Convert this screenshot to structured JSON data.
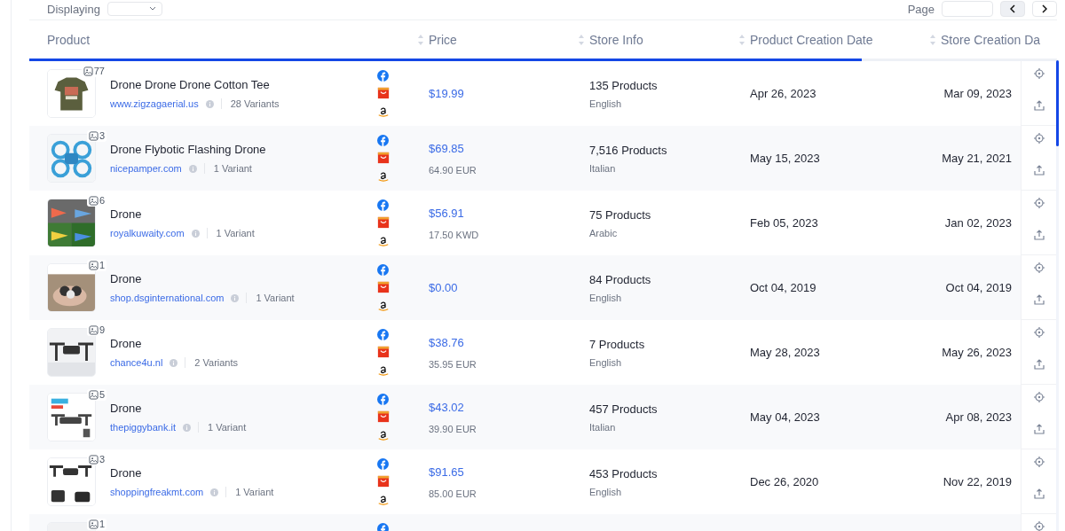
{
  "toolbar": {
    "displaying_label": "Displaying",
    "page_label": "Page"
  },
  "table": {
    "columns": [
      {
        "label": "Product",
        "sortable": false
      },
      {
        "label": "Price",
        "sortable": true
      },
      {
        "label": "Store Info",
        "sortable": true
      },
      {
        "label": "Product Creation Date",
        "sortable": true
      },
      {
        "label": "Store Creation Da",
        "sortable": true
      }
    ],
    "rows": [
      {
        "image_count": "77",
        "name": "Drone Drone Drone Cotton Tee",
        "store": "www.zigzagaerial.us",
        "variants": "28 Variants",
        "price": "$19.99",
        "products": "135 Products",
        "language": "English",
        "product_date": "Apr 26, 2023",
        "store_date": "Mar 09, 2023"
      },
      {
        "image_count": "3",
        "name": "Drone Flybotic Flashing Drone",
        "store": "nicepamper.com",
        "variants": "1 Variant",
        "price": "$69.85",
        "local_price": "64.90 EUR",
        "products": "7,516 Products",
        "language": "Italian",
        "product_date": "May 15, 2023",
        "store_date": "May 21, 2021"
      },
      {
        "image_count": "6",
        "name": "Drone",
        "store": "royalkuwaity.com",
        "variants": "1 Variant",
        "price": "$56.91",
        "local_price": "17.50 KWD",
        "products": "75 Products",
        "language": "Arabic",
        "product_date": "Feb 05, 2023",
        "store_date": "Jan 02, 2023"
      },
      {
        "image_count": "1",
        "name": "Drone",
        "store": "shop.dsginternational.com",
        "variants": "1 Variant",
        "price": "$0.00",
        "products": "84 Products",
        "language": "English",
        "product_date": "Oct 04, 2019",
        "store_date": "Oct 04, 2019"
      },
      {
        "image_count": "9",
        "name": "Drone",
        "store": "chance4u.nl",
        "variants": "2 Variants",
        "price": "$38.76",
        "local_price": "35.95 EUR",
        "products": "7 Products",
        "language": "English",
        "product_date": "May 28, 2023",
        "store_date": "May 26, 2023"
      },
      {
        "image_count": "5",
        "name": "Drone",
        "store": "thepiggybank.it",
        "variants": "1 Variant",
        "price": "$43.02",
        "local_price": "39.90 EUR",
        "products": "457 Products",
        "language": "Italian",
        "product_date": "May 04, 2023",
        "store_date": "Apr 08, 2023"
      },
      {
        "image_count": "3",
        "name": "Drone",
        "store": "shoppingfreakmt.com",
        "variants": "1 Variant",
        "price": "$91.65",
        "local_price": "85.00 EUR",
        "products": "453 Products",
        "language": "English",
        "product_date": "Dec 26, 2020",
        "store_date": "Nov 22, 2019"
      },
      {
        "image_count": "1"
      }
    ]
  }
}
